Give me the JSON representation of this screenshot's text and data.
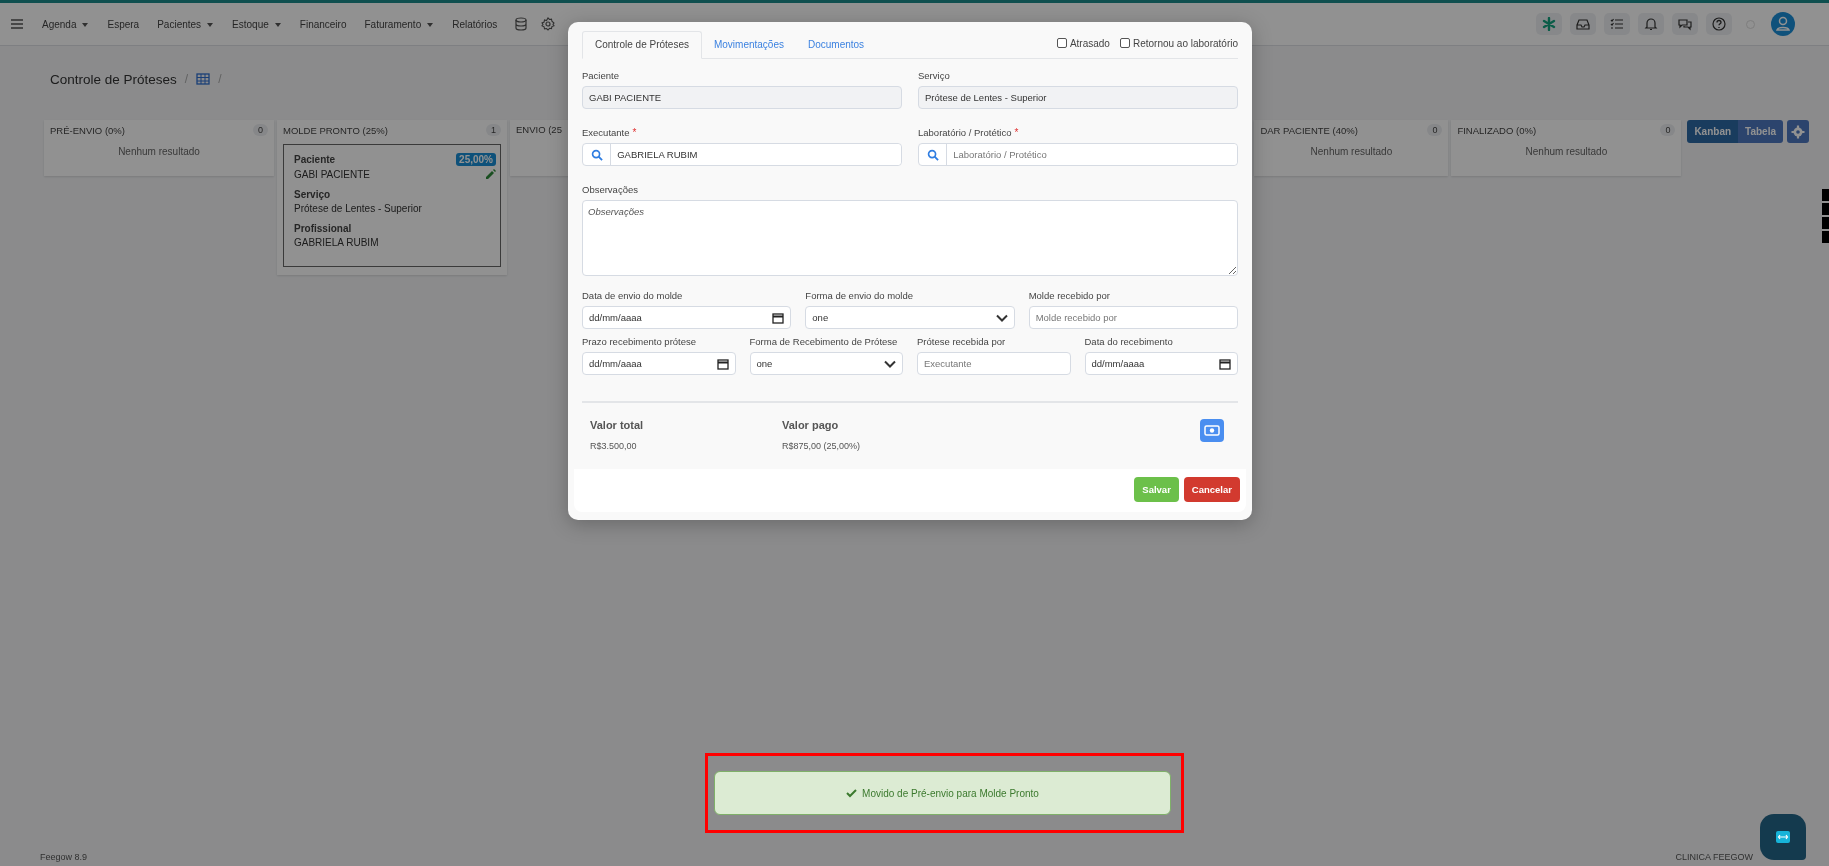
{
  "nav": {
    "items": [
      {
        "label": "Agenda",
        "caret": true
      },
      {
        "label": "Espera",
        "caret": false
      },
      {
        "label": "Pacientes",
        "caret": true
      },
      {
        "label": "Estoque",
        "caret": true
      },
      {
        "label": "Financeiro",
        "caret": false
      },
      {
        "label": "Faturamento",
        "caret": true
      },
      {
        "label": "Relatórios",
        "caret": false
      }
    ]
  },
  "breadcrumb": {
    "title": "Controle de Próteses",
    "separators": [
      "/",
      "/"
    ]
  },
  "board": {
    "columns": [
      {
        "title": "PRÉ-ENVIO (0%)",
        "count": "0",
        "empty_text": "Nenhum resultado"
      },
      {
        "title": "MOLDE PRONTO (25%)",
        "count": "1",
        "cards": [
          {
            "badge": "25,00%",
            "fields": [
              {
                "label": "Paciente",
                "value": "GABI PACIENTE"
              },
              {
                "label": "Serviço",
                "value": "Prótese de Lentes - Superior"
              },
              {
                "label": "Profissional",
                "value": "GABRIELA RUBIM"
              }
            ]
          }
        ]
      },
      {
        "title": "ENVIO (25"
      },
      {
        "title": "DAR PACIENTE (40%)",
        "cut_left": true,
        "count": "0",
        "empty_text": "Nenhum resultado"
      },
      {
        "title": "FINALIZADO (0%)",
        "count": "0",
        "empty_text": "Nenhum resultado"
      }
    ],
    "view_toggle": [
      {
        "label": "Kanban",
        "selected": true
      },
      {
        "label": "Tabela",
        "selected": false
      }
    ]
  },
  "modal": {
    "tabs": [
      {
        "label": "Controle de Próteses",
        "selected": true
      },
      {
        "label": "Movimentações",
        "selected": false
      },
      {
        "label": "Documentos",
        "selected": false
      }
    ],
    "checkboxes": [
      {
        "label": "Atrasado",
        "checked": false
      },
      {
        "label": "Retornou ao laboratório",
        "checked": false
      }
    ],
    "patient": [
      {
        "kind": "text",
        "label": "Paciente",
        "value": "GABI PACIENTE",
        "disabled": true
      },
      {
        "kind": "text",
        "label": "Serviço",
        "value": "Prótese de Lentes - Superior",
        "disabled": true
      }
    ],
    "assignment": [
      {
        "kind": "search",
        "label": "Executante",
        "required_mark": "*",
        "value": "GABRIELA RUBIM"
      },
      {
        "kind": "search",
        "label": "Laboratório / Protético",
        "required_mark": "*",
        "placeholder": "Laboratório / Protético"
      }
    ],
    "notes": [
      {
        "kind": "textarea",
        "label": "Observações",
        "placeholder": "Observações"
      }
    ],
    "mold_shipping": [
      {
        "kind": "date",
        "label": "Data de envio do molde",
        "placeholder": "dd/mm/aaaa"
      },
      {
        "kind": "select",
        "label": "Forma de envio do molde",
        "value": "one"
      },
      {
        "kind": "text",
        "label": "Molde recebido por",
        "placeholder": "Molde recebido por"
      }
    ],
    "prosthesis_receipt": [
      {
        "kind": "date",
        "label": "Prazo recebimento prótese",
        "placeholder": "dd/mm/aaaa"
      },
      {
        "kind": "select",
        "label": "Forma de Recebimento de Prótese",
        "value": "one"
      },
      {
        "kind": "text",
        "label": "Prótese recebida por",
        "placeholder": "Executante"
      },
      {
        "kind": "date",
        "label": "Data do recebimento",
        "placeholder": "dd/mm/aaaa"
      }
    ],
    "summary": [
      {
        "label": "Valor total",
        "value": "R$3.500,00"
      },
      {
        "label": "Valor pago",
        "value": "R$875,00 (25,00%)"
      }
    ],
    "actions": [
      {
        "label": "Salvar",
        "kind": "success"
      },
      {
        "label": "Cancelar",
        "kind": "danger"
      }
    ]
  },
  "toast": {
    "text": "Movido de Pré-envio para Molde Pronto"
  },
  "footer": {
    "version": "Feegow 8.9",
    "clinic": "CLINICA FEEGOW"
  }
}
